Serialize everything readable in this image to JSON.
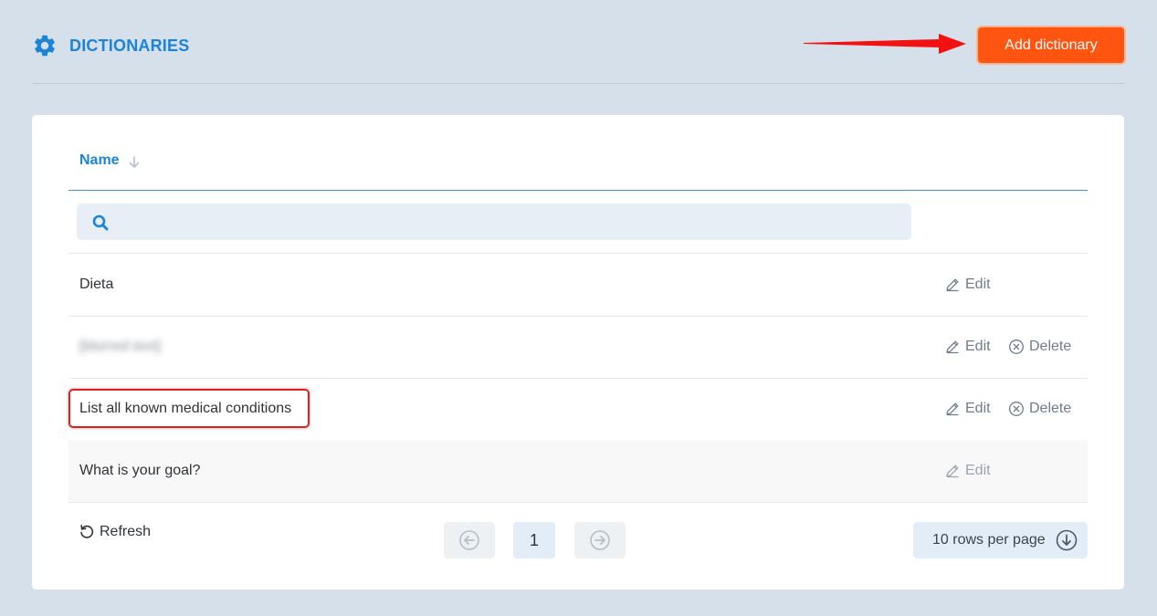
{
  "header": {
    "title": "DICTIONARIES",
    "add_button": "Add dictionary"
  },
  "table": {
    "column_name": "Name",
    "search_placeholder": "",
    "rows": [
      {
        "name": "Dieta",
        "actions": [
          "Edit"
        ]
      },
      {
        "name": "[blurred text]",
        "actions": [
          "Edit",
          "Delete"
        ]
      },
      {
        "name": "List all known medical conditions",
        "actions": [
          "Edit",
          "Delete"
        ]
      },
      {
        "name": "What is your goal?",
        "actions": [
          "Edit"
        ]
      }
    ],
    "edit_label": "Edit",
    "delete_label": "Delete"
  },
  "footer": {
    "refresh_label": "Refresh",
    "current_page": "1",
    "rows_per_page": "10 rows per page"
  },
  "colors": {
    "accent": "#1b84d8",
    "primary_button": "#ff5510",
    "annotation": "#e02020",
    "background": "#d6e0ea"
  },
  "icons": [
    "gear-icon",
    "sort-arrow-icon",
    "search-icon",
    "edit-icon",
    "delete-icon",
    "refresh-icon",
    "prev-page-icon",
    "next-page-icon",
    "dropdown-arrow-icon"
  ]
}
